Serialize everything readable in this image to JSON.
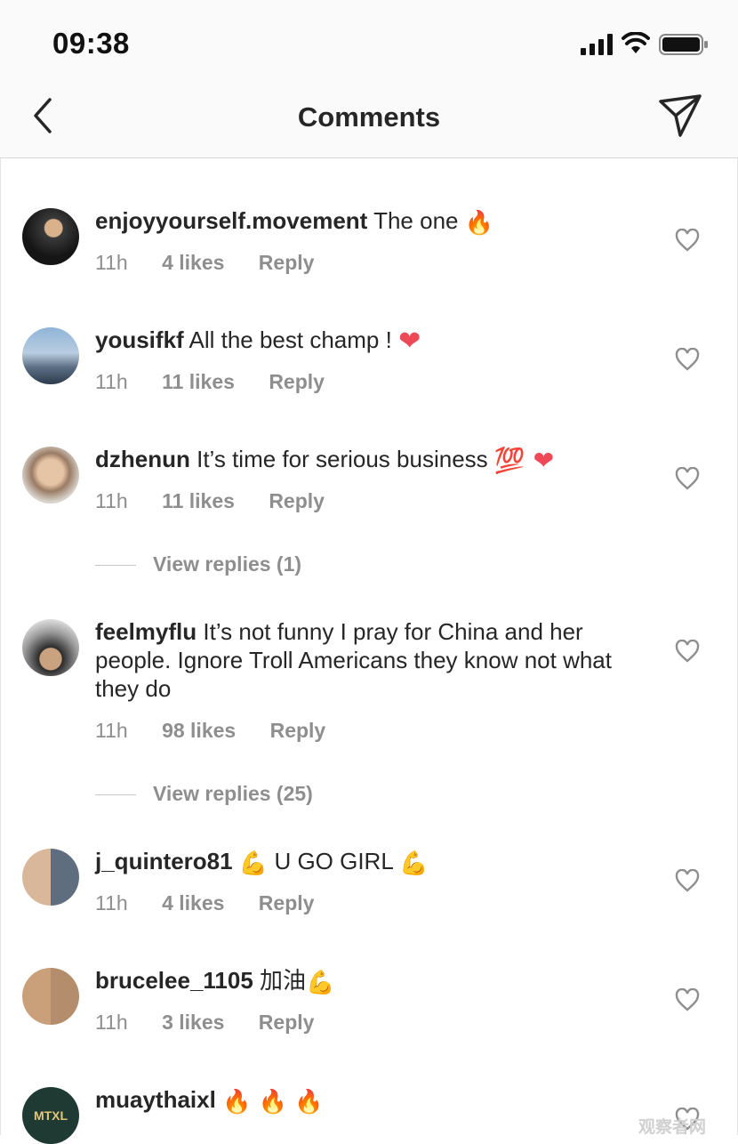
{
  "status_bar": {
    "time": "09:38"
  },
  "header": {
    "title": "Comments"
  },
  "comments": [
    {
      "user": "enjoyyourself.movement",
      "text": "The one",
      "emoji": "🔥",
      "time": "11h",
      "likes": "4 likes",
      "reply": "Reply"
    },
    {
      "user": "yousifkf",
      "text": "All the best champ !",
      "emoji": "❤",
      "time": "11h",
      "likes": "11 likes",
      "reply": "Reply"
    },
    {
      "user": "dzhenun",
      "text": "It’s time for serious business",
      "emoji": "💯 ❤",
      "time": "11h",
      "likes": "11 likes",
      "reply": "Reply",
      "view_replies": "View replies (1)"
    },
    {
      "user": "feelmyflu",
      "text": "It’s not funny I pray for China and her people. Ignore Troll Americans they know not what they do",
      "time": "11h",
      "likes": "98 likes",
      "reply": "Reply",
      "view_replies": "View replies (25)"
    },
    {
      "user": "j_quintero81",
      "text": "U GO GIRL",
      "emoji_before": "💪",
      "emoji": "💪",
      "time": "11h",
      "likes": "4 likes",
      "reply": "Reply"
    },
    {
      "user": "brucelee_1105",
      "text": "加油",
      "emoji": "💪",
      "time": "11h",
      "likes": "3 likes",
      "reply": "Reply"
    },
    {
      "user": "muaythaixl",
      "text": "",
      "emoji": "🔥 🔥 🔥",
      "avatar_text": "MTXL"
    }
  ],
  "watermark": "观察者网",
  "colors": {
    "text": "#262626",
    "muted": "#8e8e8e",
    "heart_red": "#ed4956",
    "fire": "#f77f00",
    "muscle": "#f4b400"
  }
}
